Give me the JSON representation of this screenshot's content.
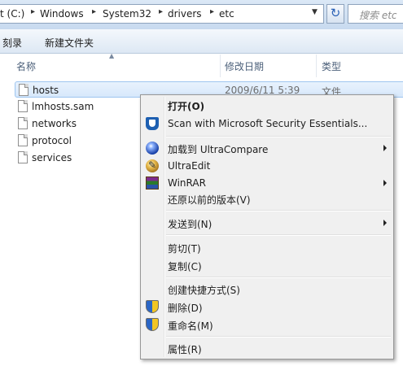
{
  "address": {
    "crumbs": [
      "t (C:)",
      "Windows",
      "System32",
      "drivers",
      "etc"
    ],
    "search_placeholder": "搜索 etc"
  },
  "toolbar": {
    "items": [
      "刻录",
      "新建文件夹"
    ]
  },
  "columns": {
    "name": "名称",
    "date": "修改日期",
    "type": "类型"
  },
  "files": [
    {
      "name": "hosts",
      "date": "2009/6/11 5:39",
      "type": "文件",
      "selected": true
    },
    {
      "name": "lmhosts.sam",
      "date": "",
      "type": ""
    },
    {
      "name": "networks",
      "date": "",
      "type": ""
    },
    {
      "name": "protocol",
      "date": "",
      "type": ""
    },
    {
      "name": "services",
      "date": "",
      "type": ""
    }
  ],
  "context_menu": {
    "open": "打开(O)",
    "scan": "Scan with Microsoft Security Essentials...",
    "ultracompare": "加载到 UltraCompare",
    "ultraedit": "UltraEdit",
    "winrar": "WinRAR",
    "restore": "还原以前的版本(V)",
    "send_to": "发送到(N)",
    "cut": "剪切(T)",
    "copy": "复制(C)",
    "shortcut": "创建快捷方式(S)",
    "delete": "删除(D)",
    "rename": "重命名(M)",
    "properties": "属性(R)"
  },
  "icons": {
    "file": "document-icon",
    "refresh": "refresh-icon",
    "shield": "uac-shield-icon"
  }
}
